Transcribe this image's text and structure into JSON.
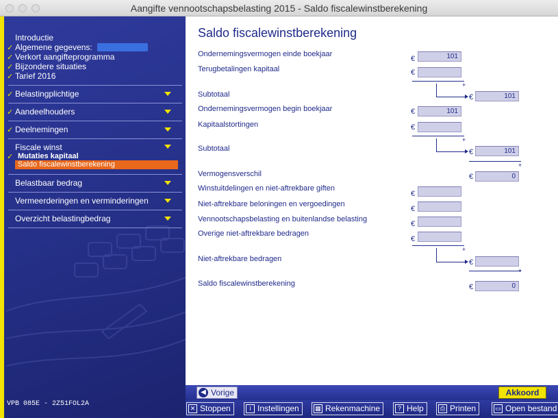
{
  "window": {
    "title": "Aangifte vennootschapsbelasting 2015 - Saldo fiscalewinstberekening"
  },
  "sidebar": {
    "intro": "Introductie",
    "top_items": [
      {
        "label": "Algemene gegevens:"
      },
      {
        "label": "Verkort aangifteprogramma"
      },
      {
        "label": "Bijzondere situaties"
      },
      {
        "label": "Tarief 2016"
      }
    ],
    "sections": [
      {
        "label": "Belastingplichtige",
        "checked": true
      },
      {
        "label": "Aandeelhouders",
        "checked": true
      },
      {
        "label": "Deelnemingen",
        "checked": true
      },
      {
        "label": "Fiscale winst",
        "checked": false
      }
    ],
    "fiscale_sub": {
      "mutaties": "Mutaties kapitaal",
      "active": "Saldo fiscalewinstberekening"
    },
    "lower_sections": [
      {
        "label": "Belastbaar bedrag"
      },
      {
        "label": "Vermeerderingen en verminderingen"
      },
      {
        "label": "Overzicht belastingbedrag"
      }
    ],
    "version": "VPB 085E - 2Z51FOL2A"
  },
  "form": {
    "title": "Saldo fiscalewinstberekening",
    "currency": "€",
    "rows": {
      "ov_einde": {
        "label": "Ondernemingsvermogen einde boekjaar",
        "value": "101"
      },
      "terugbetalingen": {
        "label": "Terugbetalingen kapitaal",
        "value": ""
      },
      "subtotaal1": {
        "label": "Subtotaal",
        "value": "101"
      },
      "ov_begin": {
        "label": "Ondernemingsvermogen begin boekjaar",
        "value": "101"
      },
      "kapitaalstortingen": {
        "label": "Kapitaalstortingen",
        "value": ""
      },
      "subtotaal2": {
        "label": "Subtotaal",
        "value": "101"
      },
      "vermogensverschil": {
        "label": "Vermogensverschil",
        "value": "0"
      },
      "winstuitdelingen": {
        "label": "Winstuitdelingen en niet-aftrekbare giften",
        "value": ""
      },
      "beloningen": {
        "label": "Niet-aftrekbare beloningen en vergoedingen",
        "value": ""
      },
      "vpb_buitenland": {
        "label": "Vennootschapsbelasting en buitenlandse belasting",
        "value": ""
      },
      "overige": {
        "label": "Overige niet-aftrekbare bedragen",
        "value": ""
      },
      "niet_aftrekbaar": {
        "label": "Niet-aftrekbare bedragen",
        "value": ""
      },
      "saldo": {
        "label": "Saldo fiscalewinstberekening",
        "value": "0"
      }
    },
    "plus_sign": "+"
  },
  "nav": {
    "prev": "Vorige",
    "ok": "Akkoord"
  },
  "toolbar": {
    "stoppen": "Stoppen",
    "instellingen": "Instellingen",
    "rekenmachine": "Rekenmachine",
    "help": "Help",
    "printen": "Printen",
    "open_bestand": "Open bestand"
  },
  "colors": {
    "sidebar": "#26318a",
    "accent_yellow": "#f2e300",
    "active_orange": "#e8681c",
    "text_blue": "#1f2a8a",
    "field_bg": "#cfcfe8"
  }
}
